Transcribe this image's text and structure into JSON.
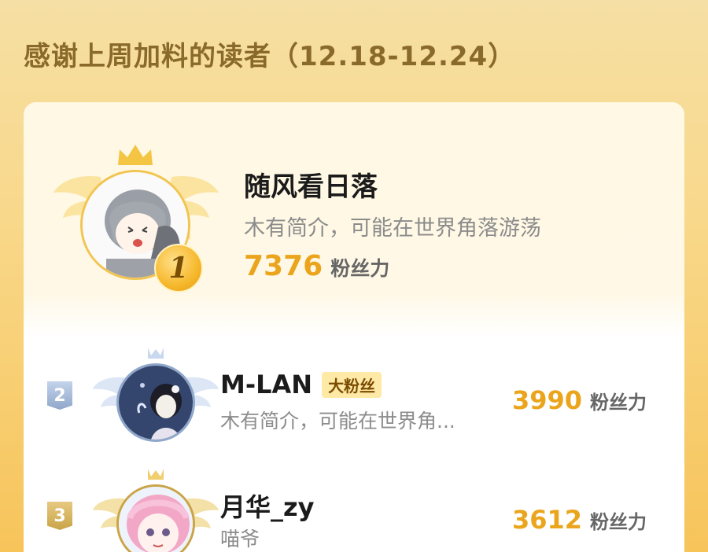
{
  "header": {
    "title": "感谢上周加料的读者（12.18-12.24）"
  },
  "top_reader": {
    "rank": "1",
    "name": "随风看日落",
    "bio": "木有简介，可能在世界角落游荡",
    "score": "7376",
    "score_unit": "粉丝力"
  },
  "readers": [
    {
      "rank": "2",
      "name": "M-LAN",
      "badge": "大粉丝",
      "bio": "木有简介，可能在世界角...",
      "score": "3990",
      "score_unit": "粉丝力"
    },
    {
      "rank": "3",
      "name": "月华_zy",
      "bio": "喵爷",
      "score": "3612",
      "score_unit": "粉丝力"
    }
  ],
  "colors": {
    "accent": "#eaa51c",
    "title": "#8a6a2a",
    "gold": "#f2c552",
    "silver_badge": "#8fa7cb",
    "bronze_badge": "#c9a448"
  },
  "icons": [
    "crown-icon",
    "wings-icon",
    "rank-medal-icon"
  ]
}
